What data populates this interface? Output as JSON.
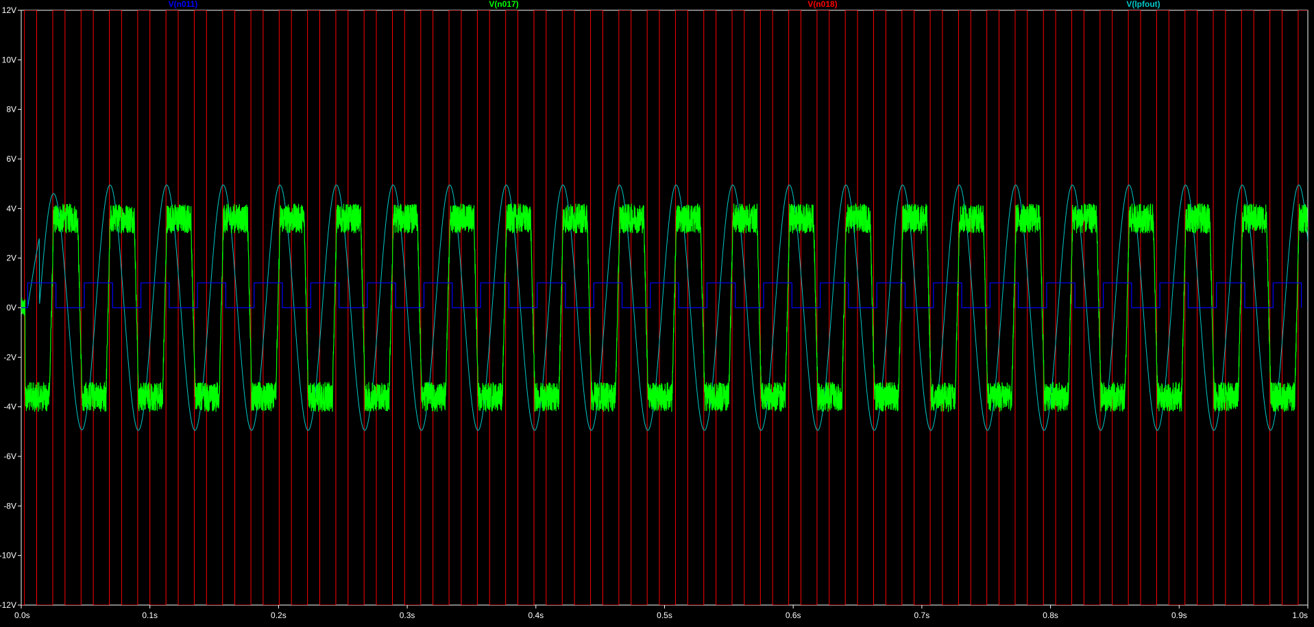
{
  "chart_data": {
    "type": "line",
    "title": "",
    "xlabel": "",
    "ylabel": "",
    "xlim": [
      0.0,
      1.0
    ],
    "ylim": [
      -12,
      12
    ],
    "grid": false,
    "x_ticks": [
      {
        "value": 0.0,
        "label": "0.0s"
      },
      {
        "value": 0.1,
        "label": "0.1s"
      },
      {
        "value": 0.2,
        "label": "0.2s"
      },
      {
        "value": 0.3,
        "label": "0.3s"
      },
      {
        "value": 0.4,
        "label": "0.4s"
      },
      {
        "value": 0.5,
        "label": "0.5s"
      },
      {
        "value": 0.6,
        "label": "0.6s"
      },
      {
        "value": 0.7,
        "label": "0.7s"
      },
      {
        "value": 0.8,
        "label": "0.8s"
      },
      {
        "value": 0.9,
        "label": "0.9s"
      },
      {
        "value": 1.0,
        "label": "1.0s"
      }
    ],
    "y_ticks": [
      {
        "value": 12,
        "label": "12V"
      },
      {
        "value": 10,
        "label": "10V"
      },
      {
        "value": 8,
        "label": "8V"
      },
      {
        "value": 6,
        "label": "6V"
      },
      {
        "value": 4,
        "label": "4V"
      },
      {
        "value": 2,
        "label": "2V"
      },
      {
        "value": 0,
        "label": "0V"
      },
      {
        "value": -2,
        "label": "-2V"
      },
      {
        "value": -4,
        "label": "-4V"
      },
      {
        "value": -6,
        "label": "-6V"
      },
      {
        "value": -8,
        "label": "-8V"
      },
      {
        "value": -10,
        "label": "-10V"
      },
      {
        "value": -12,
        "label": "-12V"
      }
    ],
    "legend_position": "top",
    "series": [
      {
        "name": "V(n011)",
        "color": "#0000ff",
        "kind": "square",
        "period": 0.044,
        "low": 0,
        "high": 1,
        "start": 0.005,
        "duty": 0.5
      },
      {
        "name": "V(n017)",
        "color": "#00ff00",
        "kind": "noisy-square",
        "period": 0.044,
        "amplitude": 4.1,
        "settled_plateau": 3,
        "ripple": 1.2,
        "start": 0.0,
        "polarity": "starts-negative"
      },
      {
        "name": "V(n018)",
        "color": "#ff0000",
        "kind": "rail-square",
        "low": -12,
        "high": 12,
        "period": 0.022,
        "rising_offset": 0.0025,
        "falling_offset": 0.012
      },
      {
        "name": "V(lpfout)",
        "color": "#00c8c8",
        "kind": "sine",
        "period": 0.044,
        "amplitude": 4.95,
        "first_peak": 0.025,
        "first_peak_value": 4.3
      }
    ]
  }
}
